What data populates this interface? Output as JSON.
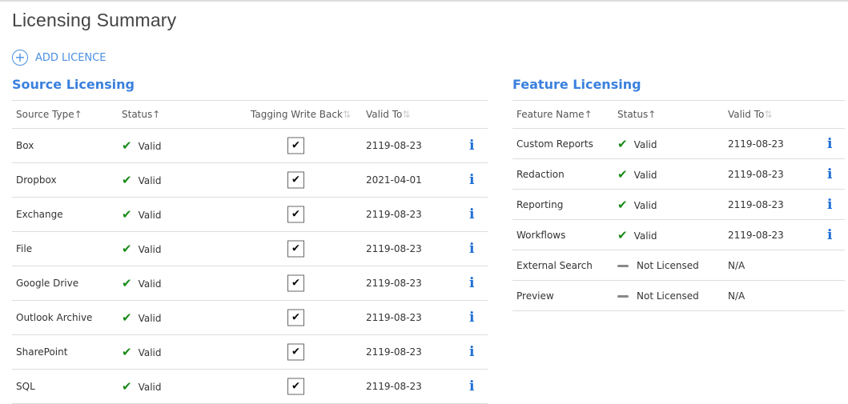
{
  "title": "Licensing Summary",
  "add_licence": "ADD LICENCE",
  "source": {
    "heading": "Source Licensing",
    "headers": {
      "type": "Source Type",
      "status": "Status",
      "tagging": "Tagging Write Back",
      "valid": "Valid To"
    },
    "rows": [
      {
        "name": "Box",
        "status": "Valid",
        "tagging": true,
        "valid": "2119-08-23"
      },
      {
        "name": "Dropbox",
        "status": "Valid",
        "tagging": true,
        "valid": "2021-04-01"
      },
      {
        "name": "Exchange",
        "status": "Valid",
        "tagging": true,
        "valid": "2119-08-23"
      },
      {
        "name": "File",
        "status": "Valid",
        "tagging": true,
        "valid": "2119-08-23"
      },
      {
        "name": "Google Drive",
        "status": "Valid",
        "tagging": true,
        "valid": "2119-08-23"
      },
      {
        "name": "Outlook Archive",
        "status": "Valid",
        "tagging": true,
        "valid": "2119-08-23"
      },
      {
        "name": "SharePoint",
        "status": "Valid",
        "tagging": true,
        "valid": "2119-08-23"
      },
      {
        "name": "SQL",
        "status": "Valid",
        "tagging": true,
        "valid": "2119-08-23"
      }
    ]
  },
  "feature": {
    "heading": "Feature Licensing",
    "headers": {
      "name": "Feature Name",
      "status": "Status",
      "valid": "Valid To"
    },
    "rows": [
      {
        "name": "Custom Reports",
        "status": "Valid",
        "valid": "2119-08-23",
        "info": true
      },
      {
        "name": "Redaction",
        "status": "Valid",
        "valid": "2119-08-23",
        "info": true
      },
      {
        "name": "Reporting",
        "status": "Valid",
        "valid": "2119-08-23",
        "info": true
      },
      {
        "name": "Workflows",
        "status": "Valid",
        "valid": "2119-08-23",
        "info": true
      },
      {
        "name": "External Search",
        "status": "Not Licensed",
        "valid": "N/A",
        "info": false
      },
      {
        "name": "Preview",
        "status": "Not Licensed",
        "valid": "N/A",
        "info": false
      }
    ]
  }
}
